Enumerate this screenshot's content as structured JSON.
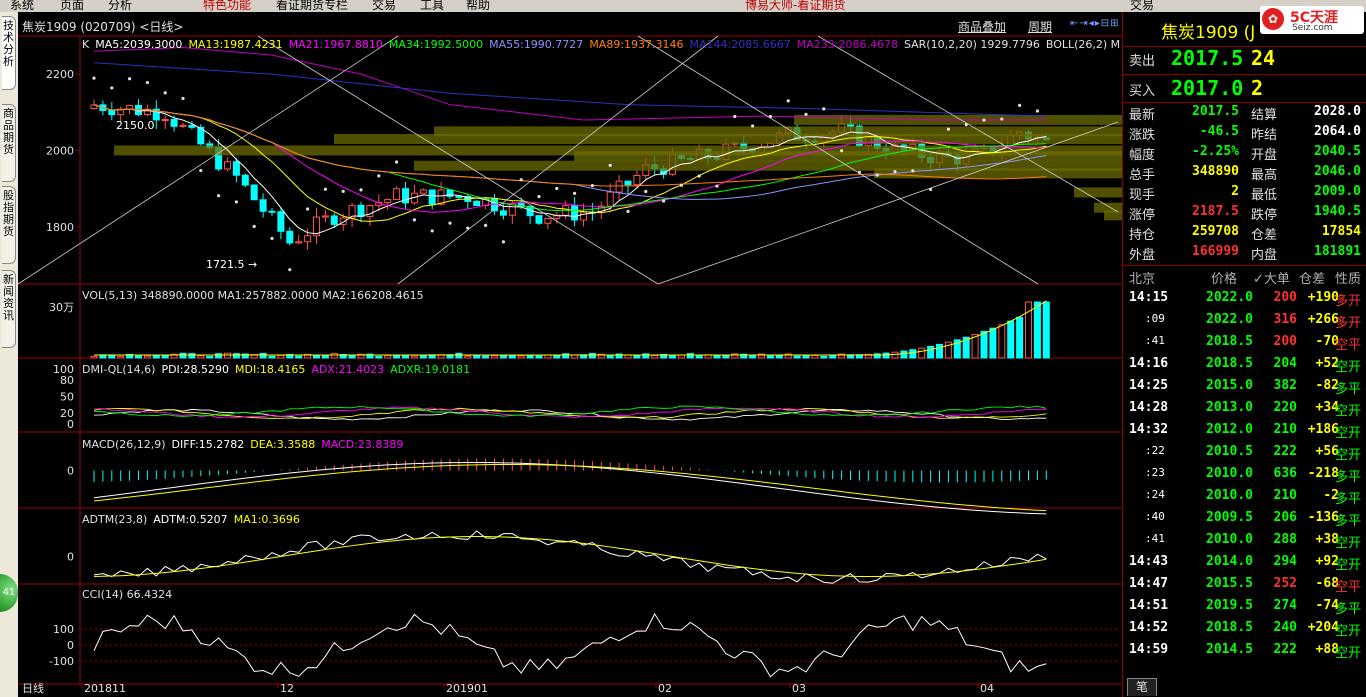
{
  "menubar": {
    "items": [
      "系统",
      "页面",
      "分析",
      "特色功能",
      "看证期货专栏",
      "交易",
      "工具",
      "帮助"
    ],
    "app_title": "博易大师-看证期货",
    "trade": "交易",
    "logo": "5C天涯",
    "logo_sub": "Seiz.com"
  },
  "sidebar": {
    "tabs": [
      "技术分析",
      "商品期货",
      "股指期货",
      "新闻资讯"
    ],
    "badge": "41"
  },
  "chart": {
    "header": "焦炭1909 (020709) <日线>",
    "buttons": [
      "商品叠加",
      "周期"
    ],
    "ma_line": [
      {
        "t": "K",
        "c": "#e0e0e0"
      },
      {
        "t": "MA5:2039.3000",
        "c": "#ffffff"
      },
      {
        "t": "MA13:1987.4231",
        "c": "#ffff00"
      },
      {
        "t": "MA21:1967.8810",
        "c": "#ff00ff"
      },
      {
        "t": "MA34:1992.5000",
        "c": "#00ff00"
      },
      {
        "t": "MA55:1990.7727",
        "c": "#9090ff"
      },
      {
        "t": "MA89:1937.3146",
        "c": "#ff8000"
      },
      {
        "t": "MA144:2085.6667",
        "c": "#3030c0"
      },
      {
        "t": "MA233:2086.4678",
        "c": "#c000c0"
      },
      {
        "t": "SAR(10,2,20) 1929.7796",
        "c": "#e0e0e0"
      },
      {
        "t": "BOLL(26,2) M",
        "c": "#e0e0e0"
      }
    ],
    "price_ticks": [
      "2200",
      "2000",
      "1800"
    ],
    "annot_high": "2150.0",
    "annot_low": "1721.5",
    "vol": {
      "title": "VOL(5,13) 348890.0000 MA1:257882.0000 MA2:166208.4615",
      "tick": "30万"
    },
    "dmi": {
      "parts": [
        {
          "t": "DMI-QL(14,6)",
          "c": "#e0e0e0"
        },
        {
          "t": "PDI:28.5290",
          "c": "#ffffff"
        },
        {
          "t": "MDI:18.4165",
          "c": "#ffff00"
        },
        {
          "t": "ADX:21.4023",
          "c": "#ff00ff"
        },
        {
          "t": "ADXR:19.0181",
          "c": "#00ff00"
        }
      ],
      "ticks": [
        "100",
        "80",
        "50",
        "20",
        "0"
      ]
    },
    "macd": {
      "parts": [
        {
          "t": "MACD(26,12,9)",
          "c": "#e0e0e0"
        },
        {
          "t": "DIFF:15.2782",
          "c": "#ffffff"
        },
        {
          "t": "DEA:3.3588",
          "c": "#ffff00"
        },
        {
          "t": "MACD:23.8389",
          "c": "#ff00ff"
        }
      ],
      "tick": "0"
    },
    "adtm": {
      "parts": [
        {
          "t": "ADTM(23,8)",
          "c": "#e0e0e0"
        },
        {
          "t": "ADTM:0.5207",
          "c": "#ffffff"
        },
        {
          "t": "MA1:0.3696",
          "c": "#ffff00"
        }
      ],
      "tick": "0"
    },
    "cci": {
      "title": "CCI(14) 66.4324",
      "ticks": [
        "100",
        "0",
        "-100"
      ]
    },
    "xaxis": {
      "label": "日线",
      "dates": [
        "201811",
        "12",
        "201901",
        "02",
        "03",
        "04"
      ]
    }
  },
  "quote": {
    "title": "焦炭1909 (J",
    "sell_label": "卖出",
    "sell_price": "2017.5",
    "sell_vol": "24",
    "buy_label": "买入",
    "buy_price": "2017.0",
    "buy_vol": "2",
    "rows": [
      {
        "l1": "最新",
        "v1": "2017.5",
        "c1": "#00ff00",
        "l2": "结算",
        "v2": "2028.0",
        "c2": "#ffffff"
      },
      {
        "l1": "涨跌",
        "v1": "-46.5",
        "c1": "#00ff00",
        "l2": "昨结",
        "v2": "2064.0",
        "c2": "#ffffff"
      },
      {
        "l1": "幅度",
        "v1": "-2.25%",
        "c1": "#00ff00",
        "l2": "开盘",
        "v2": "2040.5",
        "c2": "#00ff00"
      },
      {
        "l1": "总手",
        "v1": "348890",
        "c1": "#ffff00",
        "l2": "最高",
        "v2": "2046.0",
        "c2": "#00ff00"
      },
      {
        "l1": "现手",
        "v1": "2",
        "c1": "#ffff00",
        "l2": "最低",
        "v2": "2009.0",
        "c2": "#00ff00"
      },
      {
        "l1": "涨停",
        "v1": "2187.5",
        "c1": "#ff3030",
        "l2": "跌停",
        "v2": "1940.5",
        "c2": "#00ff00"
      },
      {
        "l1": "持仓",
        "v1": "259708",
        "c1": "#ffff00",
        "l2": "仓差",
        "v2": "17854",
        "c2": "#ffff00"
      },
      {
        "l1": "外盘",
        "v1": "166999",
        "c1": "#ff3030",
        "l2": "内盘",
        "v2": "181891",
        "c2": "#00ff00"
      }
    ],
    "tick_header": [
      "北京",
      "价格",
      "✓大单",
      "仓差",
      "性质"
    ],
    "ticks": [
      {
        "t": "14:15",
        "p": "2022.0",
        "v": "200",
        "vc": "#ff3030",
        "d": "+190",
        "n": "多开",
        "nc": "#ff3030"
      },
      {
        "t": ":09",
        "p": "2022.0",
        "v": "316",
        "vc": "#ff3030",
        "d": "+266",
        "n": "多开",
        "nc": "#ff3030"
      },
      {
        "t": ":41",
        "p": "2018.5",
        "v": "200",
        "vc": "#ff3030",
        "d": "-70",
        "n": "空平",
        "nc": "#ff3030"
      },
      {
        "t": "14:16",
        "p": "2018.5",
        "v": "204",
        "vc": "#00ff00",
        "d": "+52",
        "n": "空开",
        "nc": "#00ff00"
      },
      {
        "t": "14:25",
        "p": "2015.0",
        "v": "382",
        "vc": "#00ff00",
        "d": "-82",
        "n": "多平",
        "nc": "#00ff00"
      },
      {
        "t": "14:28",
        "p": "2013.0",
        "v": "220",
        "vc": "#00ff00",
        "d": "+34",
        "n": "空开",
        "nc": "#00ff00"
      },
      {
        "t": "14:32",
        "p": "2012.0",
        "v": "210",
        "vc": "#00ff00",
        "d": "+186",
        "n": "空开",
        "nc": "#00ff00"
      },
      {
        "t": ":22",
        "p": "2010.5",
        "v": "222",
        "vc": "#00ff00",
        "d": "+56",
        "n": "空开",
        "nc": "#00ff00"
      },
      {
        "t": ":23",
        "p": "2010.0",
        "v": "636",
        "vc": "#00ff00",
        "d": "-218",
        "n": "多平",
        "nc": "#00ff00"
      },
      {
        "t": ":24",
        "p": "2010.0",
        "v": "210",
        "vc": "#00ff00",
        "d": "-2",
        "n": "多平",
        "nc": "#00ff00"
      },
      {
        "t": ":40",
        "p": "2009.5",
        "v": "206",
        "vc": "#00ff00",
        "d": "-136",
        "n": "多平",
        "nc": "#00ff00"
      },
      {
        "t": ":41",
        "p": "2010.0",
        "v": "288",
        "vc": "#00ff00",
        "d": "+38",
        "n": "空开",
        "nc": "#00ff00"
      },
      {
        "t": "14:43",
        "p": "2014.0",
        "v": "294",
        "vc": "#00ff00",
        "d": "+92",
        "n": "空开",
        "nc": "#00ff00"
      },
      {
        "t": "14:47",
        "p": "2015.5",
        "v": "252",
        "vc": "#ff3030",
        "d": "-68",
        "n": "空平",
        "nc": "#ff3030"
      },
      {
        "t": "14:51",
        "p": "2019.5",
        "v": "274",
        "vc": "#00ff00",
        "d": "-74",
        "n": "多平",
        "nc": "#00ff00"
      },
      {
        "t": "14:52",
        "p": "2018.5",
        "v": "240",
        "vc": "#00ff00",
        "d": "+204",
        "n": "空开",
        "nc": "#00ff00"
      },
      {
        "t": "14:59",
        "p": "2014.5",
        "v": "222",
        "vc": "#00ff00",
        "d": "+88",
        "n": "空开",
        "nc": "#00ff00"
      }
    ],
    "bottom_tab": "笔"
  }
}
